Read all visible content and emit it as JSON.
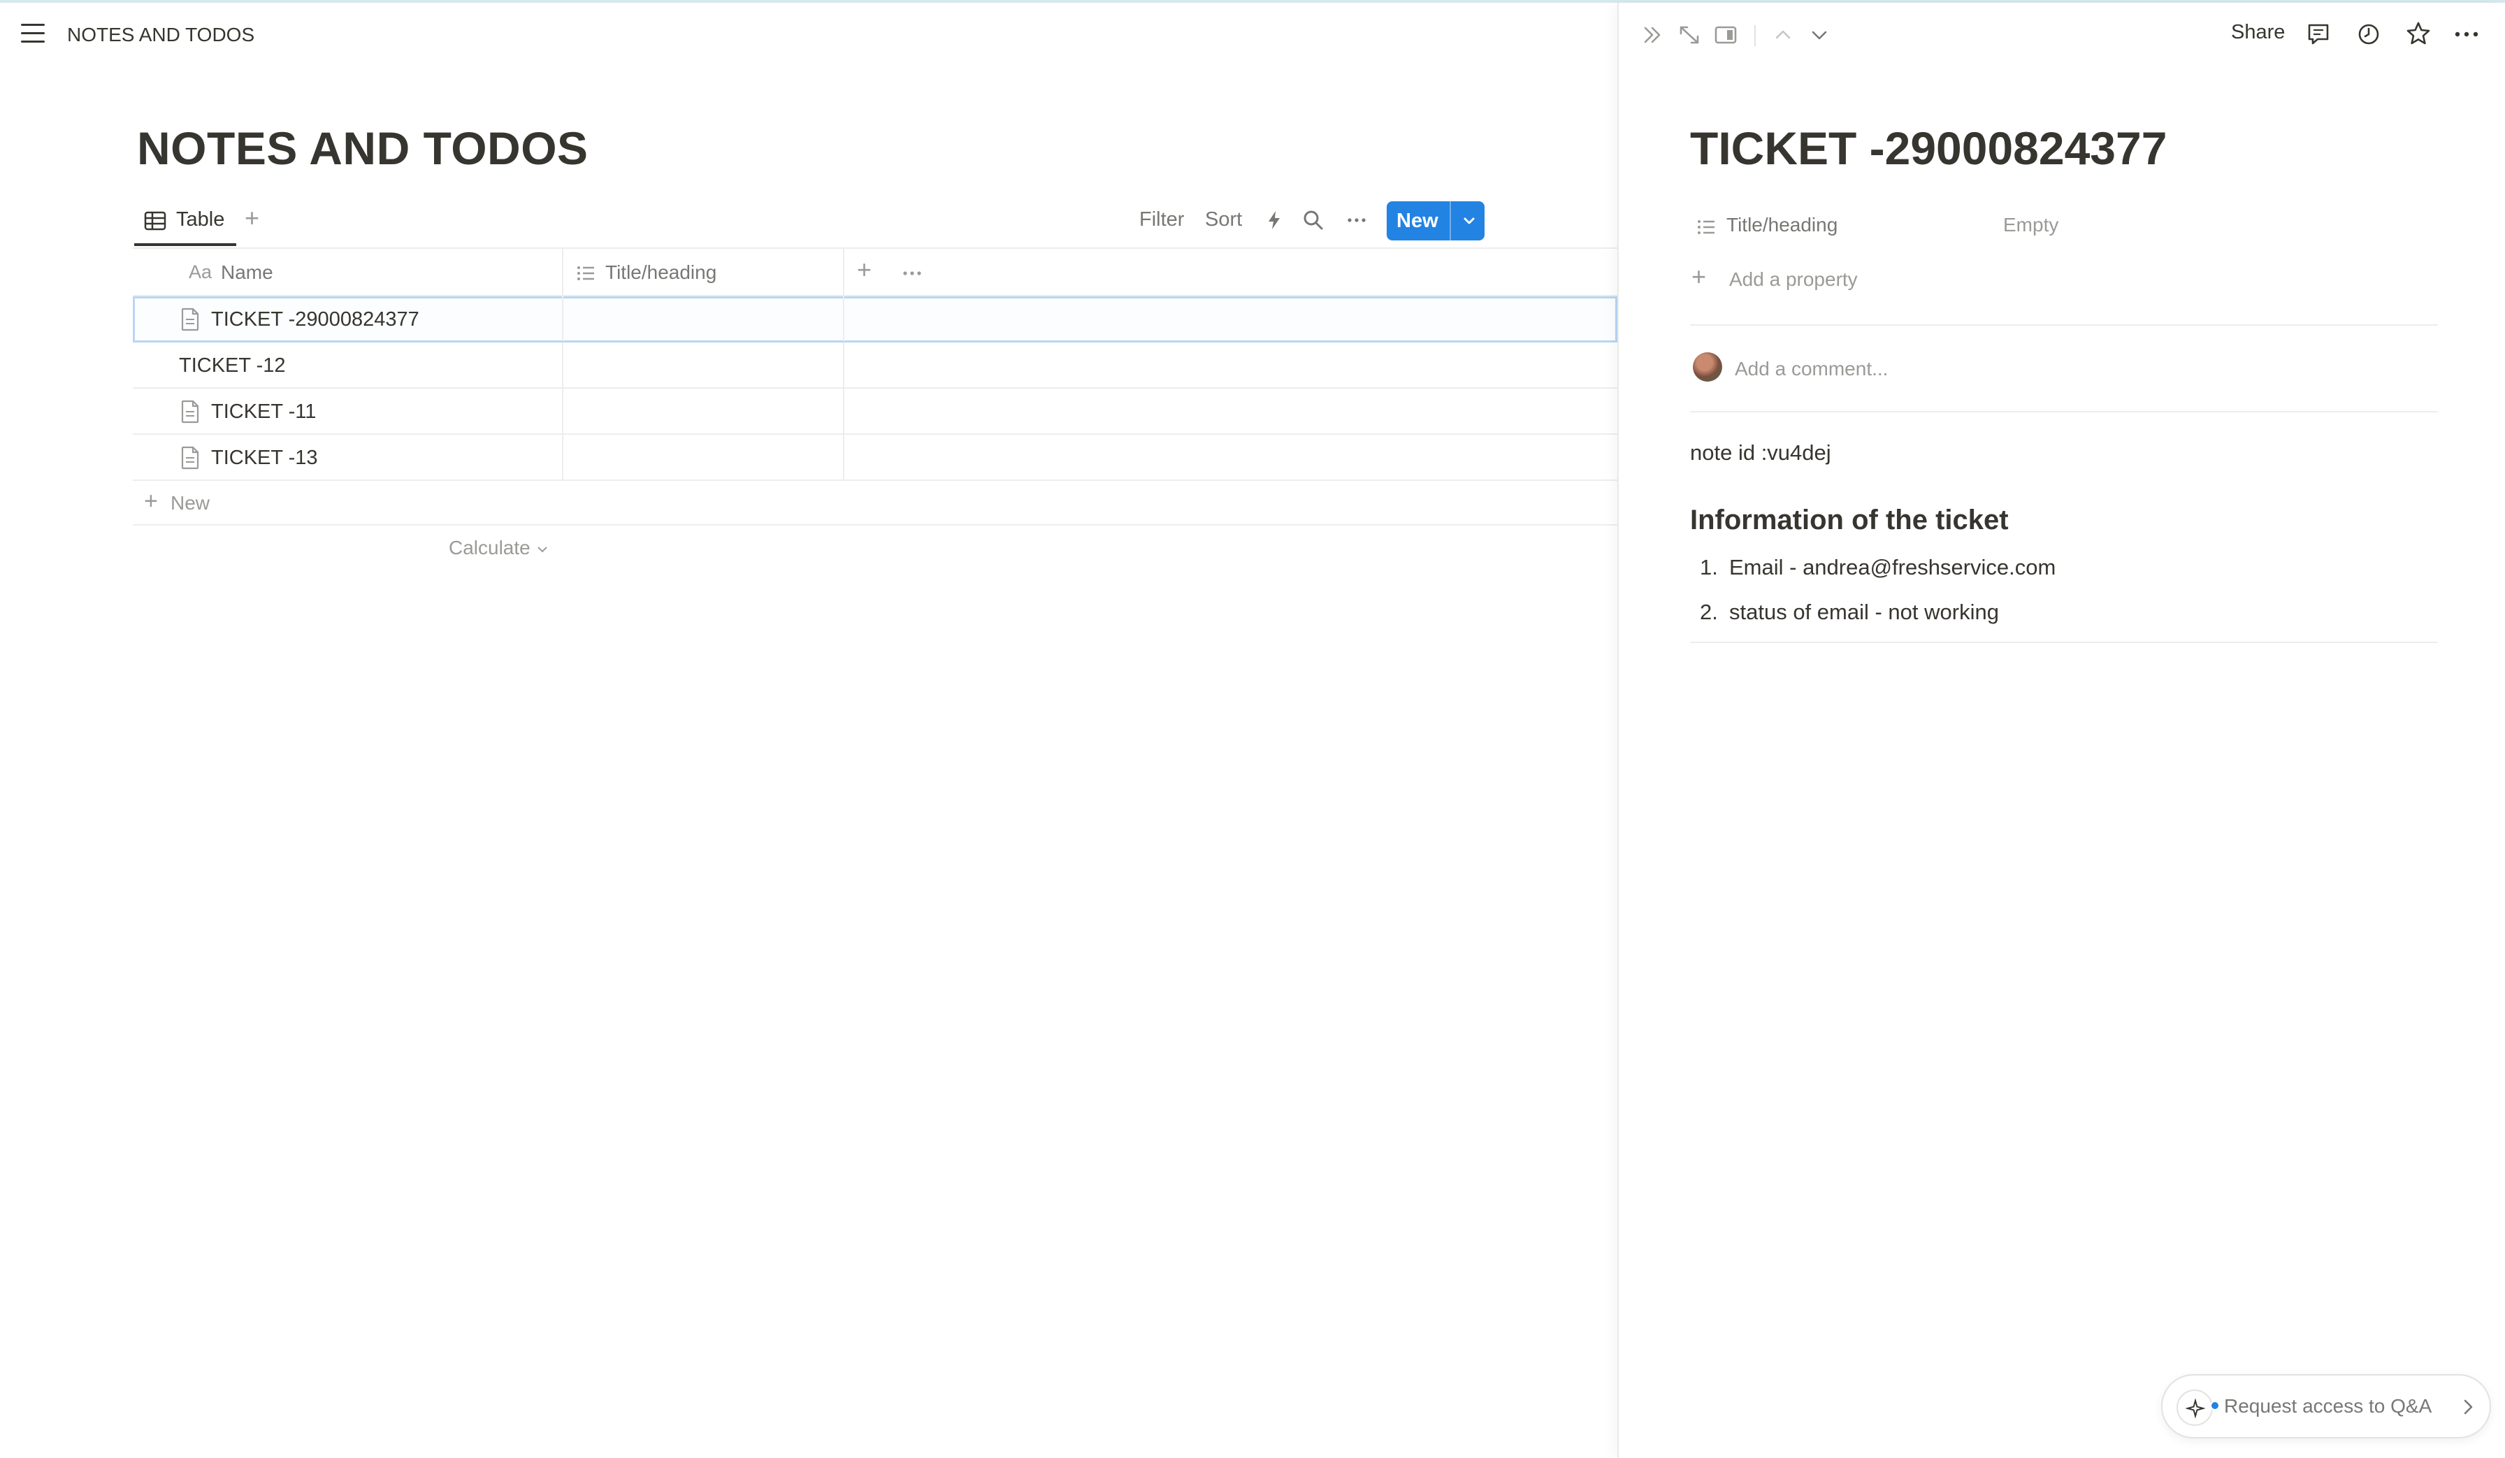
{
  "breadcrumb": "NOTES AND TODOS",
  "page": {
    "title": "NOTES AND TODOS",
    "view_tab": "Table",
    "toolbar": {
      "filter": "Filter",
      "sort": "Sort",
      "new": "New"
    }
  },
  "table": {
    "columns": {
      "name": "Name",
      "name_prefix": "Aa",
      "title": "Title/heading"
    },
    "rows": [
      {
        "name": "TICKET -29000824377",
        "has_icon": true,
        "title": ""
      },
      {
        "name": "TICKET -12",
        "has_icon": false,
        "title": ""
      },
      {
        "name": "TICKET -11",
        "has_icon": true,
        "title": ""
      },
      {
        "name": "TICKET -13",
        "has_icon": true,
        "title": ""
      }
    ],
    "new_row": "New",
    "calculate": "Calculate"
  },
  "panel": {
    "share": "Share",
    "title": "TICKET -29000824377",
    "property": {
      "name": "Title/heading",
      "value": "Empty"
    },
    "add_property": "Add a property",
    "comment_placeholder": "Add a comment...",
    "note_id": "note id :vu4dej",
    "heading": "Information of the ticket",
    "list": [
      {
        "num": "1.",
        "text": "Email - andrea@freshservice.com"
      },
      {
        "num": "2.",
        "text": "status of email - not working"
      }
    ],
    "qa_button": "Request access to Q&A"
  },
  "colors": {
    "accent": "#2383e2",
    "text": "#37352f",
    "muted": "#9b9a97"
  }
}
